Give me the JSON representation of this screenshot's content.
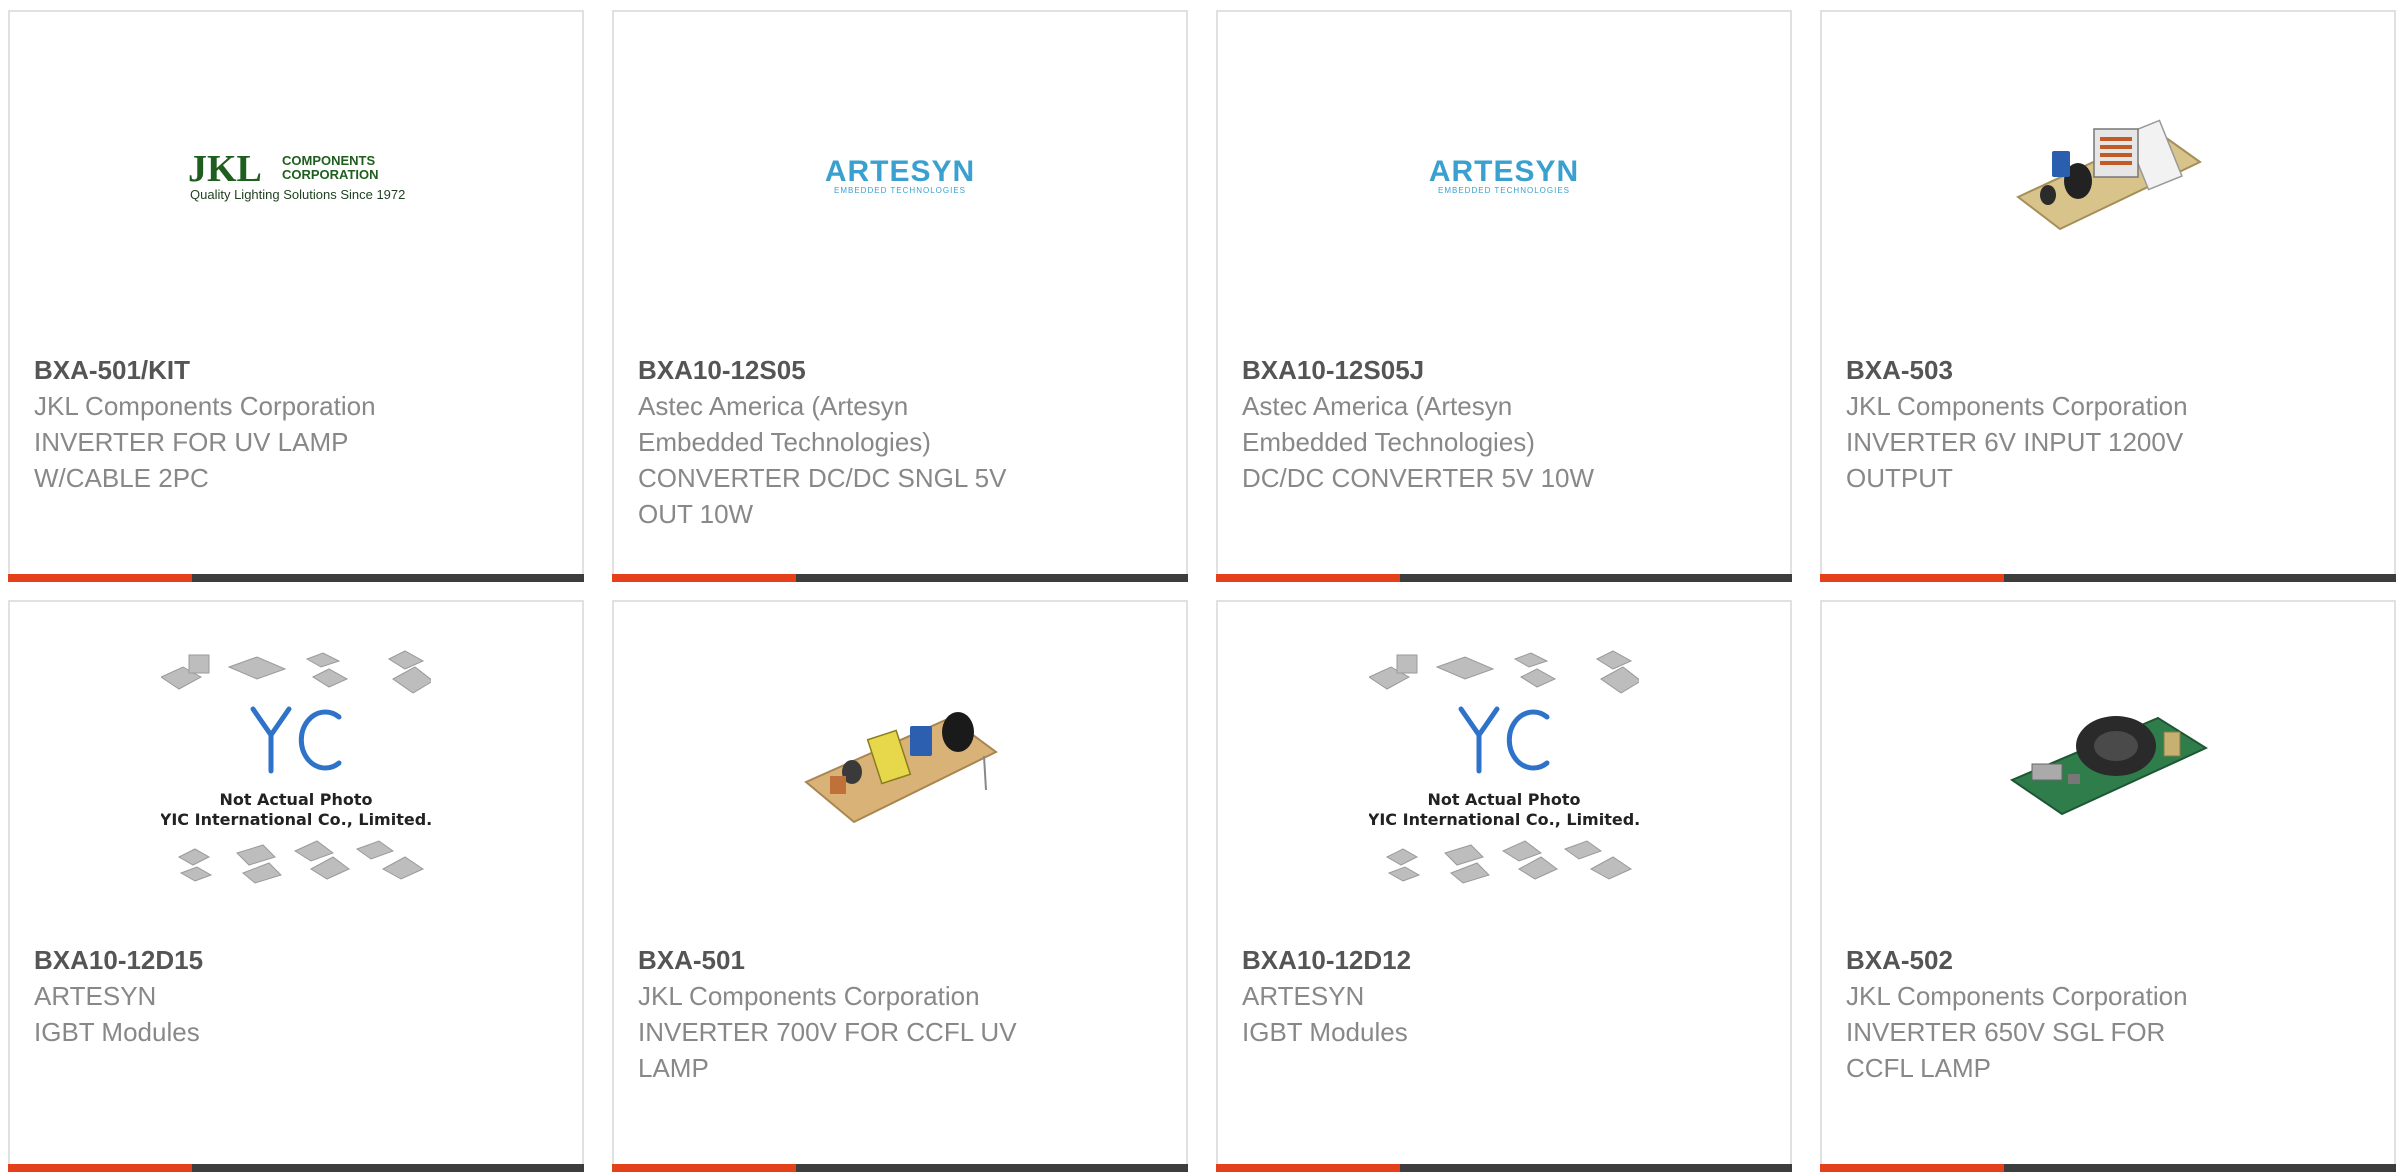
{
  "colors": {
    "accent": "#e3401b",
    "bar": "#3d3d3d",
    "part_number": "#555555",
    "text": "#888888",
    "border": "#e1e1e1"
  },
  "products": [
    {
      "part_number": "BXA-501/KIT",
      "manufacturer": "JKL Components Corporation",
      "description": "INVERTER FOR UV LAMP\nW/CABLE 2PC",
      "image": "jkl-logo",
      "logo": {
        "brand": "JKL",
        "line1": "COMPONENTS",
        "line2": "CORPORATION",
        "tagline": "Quality Lighting Solutions Since 1972"
      }
    },
    {
      "part_number": "BXA10-12S05",
      "manufacturer": "Astec America (Artesyn\nEmbedded Technologies)",
      "description": "CONVERTER DC/DC SNGL 5V\nOUT 10W",
      "image": "artesyn-logo",
      "logo": {
        "brand": "ARTESYN",
        "tagline": "EMBEDDED TECHNOLOGIES"
      }
    },
    {
      "part_number": "BXA10-12S05J",
      "manufacturer": "Astec America (Artesyn\nEmbedded Technologies)",
      "description": "DC/DC CONVERTER 5V 10W",
      "image": "artesyn-logo",
      "logo": {
        "brand": "ARTESYN",
        "tagline": "EMBEDDED TECHNOLOGIES"
      }
    },
    {
      "part_number": "BXA-503",
      "manufacturer": "JKL Components Corporation",
      "description": "INVERTER 6V INPUT 1200V\nOUTPUT",
      "image": "inverter-board-photo"
    },
    {
      "part_number": "BXA10-12D15",
      "manufacturer": "ARTESYN",
      "description": "IGBT Modules",
      "image": "yic-placeholder",
      "placeholder": {
        "brand": "YIC",
        "line1": "Not Actual Photo",
        "line2": "YIC International Co., Limited."
      }
    },
    {
      "part_number": "BXA-501",
      "manufacturer": "JKL Components Corporation",
      "description": "INVERTER 700V FOR CCFL UV\nLAMP",
      "image": "inverter-board-photo"
    },
    {
      "part_number": "BXA10-12D12",
      "manufacturer": "ARTESYN",
      "description": "IGBT Modules",
      "image": "yic-placeholder",
      "placeholder": {
        "brand": "YIC",
        "line1": "Not Actual Photo",
        "line2": "YIC International Co., Limited."
      }
    },
    {
      "part_number": "BXA-502",
      "manufacturer": "JKL Components Corporation",
      "description": "INVERTER 650V SGL FOR\nCCFL LAMP",
      "image": "inverter-board-photo"
    }
  ]
}
